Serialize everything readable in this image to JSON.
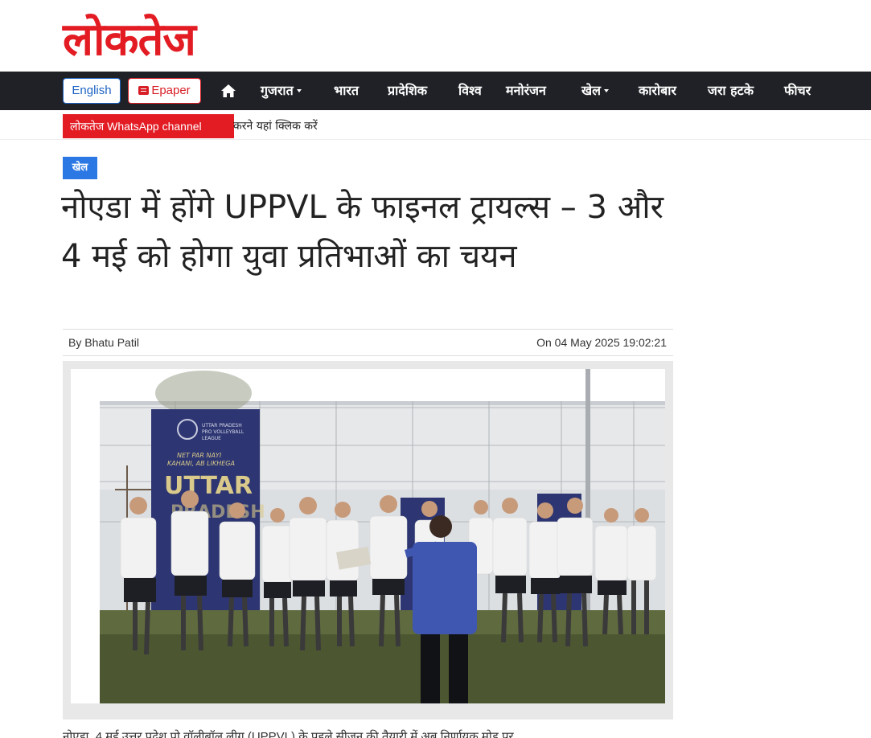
{
  "site": {
    "logo_text": "लोकतेज",
    "brand_color": "#e31b23"
  },
  "nav": {
    "english_label": "English",
    "epaper_label": "Epaper",
    "home_icon": "home-icon",
    "items": [
      {
        "label": "गुजरात",
        "dropdown": true
      },
      {
        "label": "भारत",
        "dropdown": false
      },
      {
        "label": "प्रादेशिक",
        "dropdown": false
      },
      {
        "label": "विश्व",
        "dropdown": false
      },
      {
        "label": "मनोरंजन",
        "dropdown": false
      },
      {
        "label": "खेल",
        "dropdown": true
      },
      {
        "label": "कारोबार",
        "dropdown": false
      },
      {
        "label": "जरा हटके",
        "dropdown": false
      },
      {
        "label": "फीचर",
        "dropdown": false
      }
    ]
  },
  "ticker": {
    "badge": "लोकतेज WhatsApp channel",
    "text": "करने यहां क्लिक करें"
  },
  "article": {
    "category": "खेल",
    "title": "नोएडा में होंगे UPPVL के फाइनल ट्रायल्स – 3 और 4 मई को होगा युवा प्रतिभाओं का चयन",
    "author": "By Bhatu Patil",
    "date": "On 04 May 2025 19:02:21",
    "banner_text": [
      "UTTAR PRADESH",
      "PRO VOLLEYBALL",
      "LEAGUE",
      "NET PAR NAYI",
      "KAHANI, AB LIKHEGA",
      "UTTAR",
      "PRADESH"
    ],
    "body_start": "नोएडा, 4 मई उत्तर प्रदेश प्रो वॉलीबॉल लीग (UPPVL) के पहले सीजन की तैयारी में अब निर्णायक मोड़ पर"
  },
  "colors": {
    "navbar": "#1f2126",
    "category": "#2b78e4",
    "accent": "#e31b23"
  }
}
